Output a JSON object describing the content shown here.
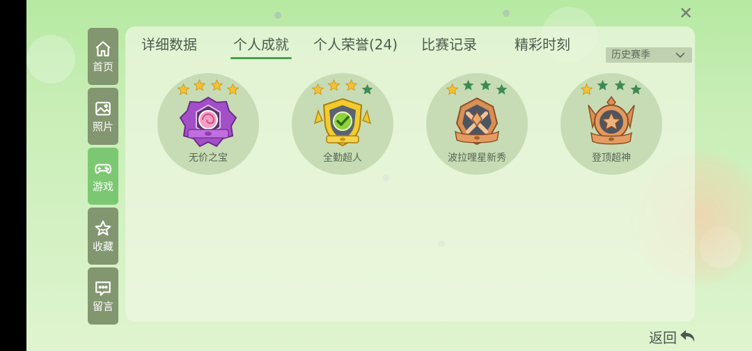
{
  "sidebar": {
    "items": [
      {
        "label": "首页",
        "icon": "home-icon"
      },
      {
        "label": "照片",
        "icon": "photo-icon"
      },
      {
        "label": "游戏",
        "icon": "gamepad-icon",
        "active": true
      },
      {
        "label": "收藏",
        "icon": "star-icon"
      },
      {
        "label": "留言",
        "icon": "message-icon"
      }
    ]
  },
  "tabs": [
    {
      "label": "详细数据"
    },
    {
      "label": "个人成就",
      "active": true
    },
    {
      "label": "个人荣誉(24)"
    },
    {
      "label": "比赛记录"
    },
    {
      "label": "精彩时刻"
    }
  ],
  "season_select": {
    "value": "历史赛季",
    "icon": "chevron-down-icon"
  },
  "achievements": [
    {
      "name": "无价之宝",
      "stars_earned": 4,
      "stars_total": 4,
      "badge": "purple-candy-badge"
    },
    {
      "name": "全勤超人",
      "stars_earned": 3,
      "stars_total": 4,
      "badge": "gold-check-shield-badge"
    },
    {
      "name": "波拉哩星新秀",
      "stars_earned": 1,
      "stars_total": 4,
      "badge": "bronze-crossed-badge"
    },
    {
      "name": "登顶超神",
      "stars_earned": 1,
      "stars_total": 4,
      "badge": "bronze-star-medal-badge"
    }
  ],
  "back_button": {
    "label": "返回",
    "icon": "back-arrow-icon"
  },
  "close_button": {
    "icon": "close-icon"
  },
  "colors": {
    "active_tab_underline": "#4aa048",
    "sidebar_active": "#7cc872",
    "sidebar_inactive": "#82966f",
    "star_earned": "#f2c233",
    "star_unearned": "#3e8a55"
  }
}
